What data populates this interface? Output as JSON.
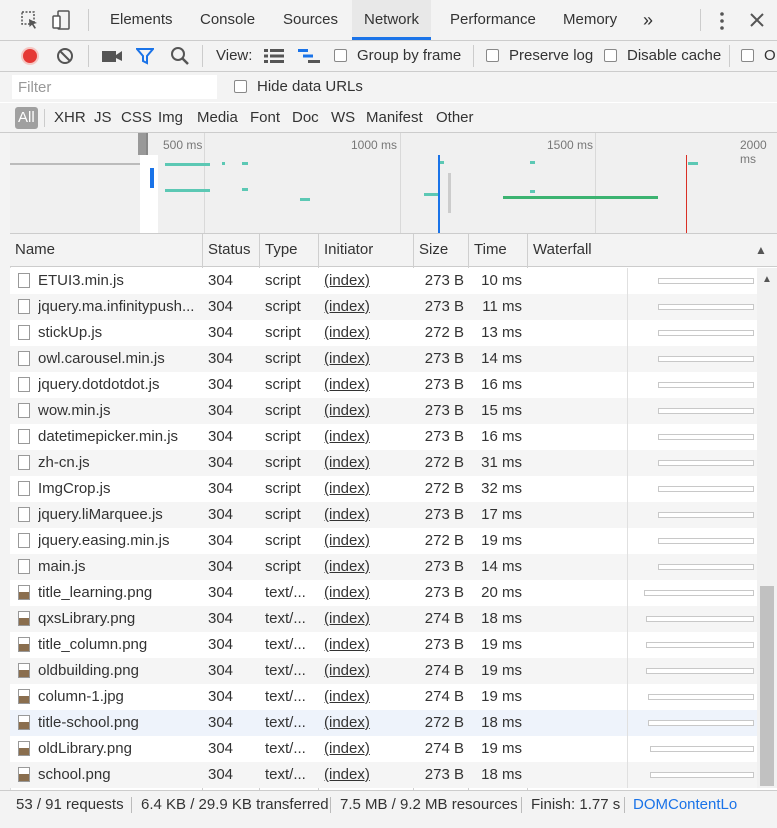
{
  "tabs": {
    "elements": "Elements",
    "console": "Console",
    "sources": "Sources",
    "network": "Network",
    "performance": "Performance",
    "memory": "Memory",
    "more": "»"
  },
  "toolbar": {
    "view_label": "View:",
    "group_by_frame": "Group by frame",
    "preserve_log": "Preserve log",
    "disable_cache": "Disable cache",
    "offline_partial": "O"
  },
  "filter": {
    "placeholder": "Filter",
    "hide_data_urls": "Hide data URLs"
  },
  "types": [
    "All",
    "XHR",
    "JS",
    "CSS",
    "Img",
    "Media",
    "Font",
    "Doc",
    "WS",
    "Manifest",
    "Other"
  ],
  "overview": {
    "labels": [
      "500 ms",
      "1000 ms",
      "1500 ms",
      "2000 ms"
    ]
  },
  "columns": {
    "name": "Name",
    "status": "Status",
    "type": "Type",
    "initiator": "Initiator",
    "size": "Size",
    "time": "Time",
    "waterfall": "Waterfall",
    "sort_icon": "▲"
  },
  "rows": [
    {
      "name": "ETUI3.min.js",
      "status": "304",
      "type": "script",
      "initiator": "(index)",
      "size": "273 B",
      "time": "10 ms",
      "icon": "file-icon"
    },
    {
      "name": "jquery.ma.infinitypush...",
      "status": "304",
      "type": "script",
      "initiator": "(index)",
      "size": "273 B",
      "time": "11 ms",
      "icon": "file-icon"
    },
    {
      "name": "stickUp.js",
      "status": "304",
      "type": "script",
      "initiator": "(index)",
      "size": "272 B",
      "time": "13 ms",
      "icon": "file-icon"
    },
    {
      "name": "owl.carousel.min.js",
      "status": "304",
      "type": "script",
      "initiator": "(index)",
      "size": "273 B",
      "time": "14 ms",
      "icon": "file-icon"
    },
    {
      "name": "jquery.dotdotdot.js",
      "status": "304",
      "type": "script",
      "initiator": "(index)",
      "size": "273 B",
      "time": "16 ms",
      "icon": "file-icon"
    },
    {
      "name": "wow.min.js",
      "status": "304",
      "type": "script",
      "initiator": "(index)",
      "size": "273 B",
      "time": "15 ms",
      "icon": "file-icon"
    },
    {
      "name": "datetimepicker.min.js",
      "status": "304",
      "type": "script",
      "initiator": "(index)",
      "size": "273 B",
      "time": "16 ms",
      "icon": "file-icon"
    },
    {
      "name": "zh-cn.js",
      "status": "304",
      "type": "script",
      "initiator": "(index)",
      "size": "272 B",
      "time": "31 ms",
      "icon": "file-icon"
    },
    {
      "name": "ImgCrop.js",
      "status": "304",
      "type": "script",
      "initiator": "(index)",
      "size": "272 B",
      "time": "32 ms",
      "icon": "file-icon"
    },
    {
      "name": "jquery.liMarquee.js",
      "status": "304",
      "type": "script",
      "initiator": "(index)",
      "size": "273 B",
      "time": "17 ms",
      "icon": "file-icon"
    },
    {
      "name": "jquery.easing.min.js",
      "status": "304",
      "type": "script",
      "initiator": "(index)",
      "size": "272 B",
      "time": "19 ms",
      "icon": "file-icon"
    },
    {
      "name": "main.js",
      "status": "304",
      "type": "script",
      "initiator": "(index)",
      "size": "273 B",
      "time": "14 ms",
      "icon": "file-icon"
    },
    {
      "name": "title_learning.png",
      "status": "304",
      "type": "text/...",
      "initiator": "(index)",
      "size": "273 B",
      "time": "20 ms",
      "icon": "image-thumb-icon"
    },
    {
      "name": "qxsLibrary.png",
      "status": "304",
      "type": "text/...",
      "initiator": "(index)",
      "size": "274 B",
      "time": "18 ms",
      "icon": "image-thumb-icon"
    },
    {
      "name": "title_column.png",
      "status": "304",
      "type": "text/...",
      "initiator": "(index)",
      "size": "273 B",
      "time": "19 ms",
      "icon": "image-thumb-icon"
    },
    {
      "name": "oldbuilding.png",
      "status": "304",
      "type": "text/...",
      "initiator": "(index)",
      "size": "274 B",
      "time": "19 ms",
      "icon": "image-thumb-icon"
    },
    {
      "name": "column-1.jpg",
      "status": "304",
      "type": "text/...",
      "initiator": "(index)",
      "size": "274 B",
      "time": "19 ms",
      "icon": "image-thumb-icon"
    },
    {
      "name": "title-school.png",
      "status": "304",
      "type": "text/...",
      "initiator": "(index)",
      "size": "272 B",
      "time": "18 ms",
      "icon": "image-thumb-icon"
    },
    {
      "name": "oldLibrary.png",
      "status": "304",
      "type": "text/...",
      "initiator": "(index)",
      "size": "274 B",
      "time": "19 ms",
      "icon": "image-thumb-icon"
    },
    {
      "name": "school.png",
      "status": "304",
      "type": "text/...",
      "initiator": "(index)",
      "size": "273 B",
      "time": "18 ms",
      "icon": "image-thumb-icon"
    }
  ],
  "status": {
    "requests": "53 / 91 requests",
    "transferred": "6.4 KB / 29.9 KB transferred",
    "resources": "7.5 MB / 9.2 MB resources",
    "finish": "Finish: 1.77 s",
    "dom_content_loaded": "DOMContentLo"
  },
  "colors": {
    "record_red": "#e53935",
    "filter_blue": "#1a73e8",
    "link_blue": "#1a73e8",
    "bar_teal": "#5cc8b4",
    "bar_green": "#3cb371",
    "load_red": "#d93025",
    "dcl_blue": "#1a73e8"
  }
}
